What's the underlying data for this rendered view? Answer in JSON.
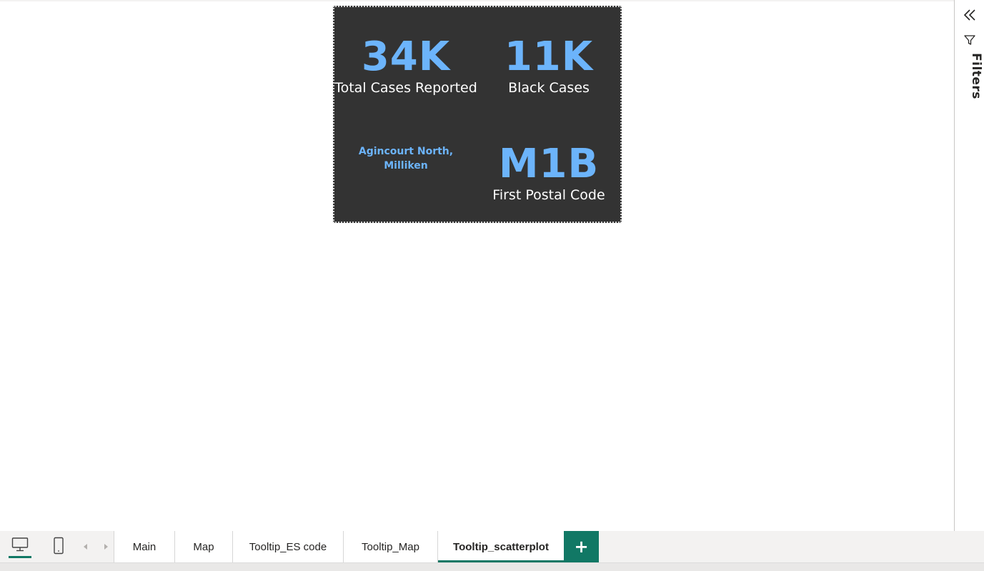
{
  "kpi_card": {
    "total_cases": {
      "value": "34K",
      "label": "Total Cases Reported"
    },
    "black_cases": {
      "value": "11K",
      "label": "Black Cases"
    },
    "neighbourhood": {
      "line1": "Agincourt North,",
      "line2": "Milliken"
    },
    "postal_code": {
      "value": "M1B",
      "label": "First Postal Code"
    }
  },
  "filters_pane": {
    "label": "Filters",
    "collapse_icon": "double-chevron-left-icon",
    "filter_icon": "funnel-icon"
  },
  "tabbar": {
    "desktop_icon": "desktop-icon",
    "mobile_icon": "mobile-icon",
    "tabs": [
      {
        "label": "Main",
        "active": false
      },
      {
        "label": "Map",
        "active": false
      },
      {
        "label": "Tooltip_ES code",
        "active": false
      },
      {
        "label": "Tooltip_Map",
        "active": false
      },
      {
        "label": "Tooltip_scatterplot",
        "active": true
      }
    ],
    "add_label": "+"
  },
  "colors": {
    "accent": "#117865",
    "kpi_value": "#6cb4fb",
    "card_bg": "#333333"
  }
}
